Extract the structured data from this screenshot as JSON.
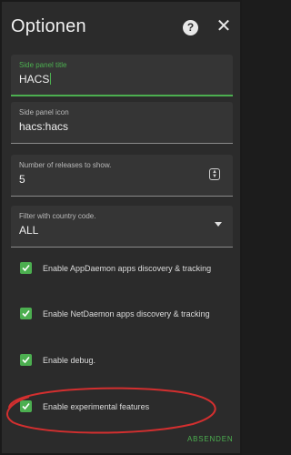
{
  "dialog": {
    "title": "Optionen",
    "help_icon": "help-circle-icon",
    "close_icon": "close-icon",
    "help_glyph": "?",
    "close_glyph": "✕"
  },
  "fields": {
    "side_panel_title": {
      "label": "Side panel title",
      "value": "HACS"
    },
    "side_panel_icon": {
      "label": "Side panel icon",
      "value": "hacs:hacs"
    },
    "releases": {
      "label": "Number of releases to show.",
      "value": "5"
    },
    "country": {
      "label": "Filter with country code.",
      "value": "ALL"
    }
  },
  "checkboxes": [
    {
      "label": "Enable AppDaemon apps discovery & tracking",
      "checked": true
    },
    {
      "label": "Enable NetDaemon apps discovery & tracking",
      "checked": true
    },
    {
      "label": "Enable debug.",
      "checked": true
    },
    {
      "label": "Enable experimental features",
      "checked": true
    }
  ],
  "actions": {
    "submit_label": "ABSENDEN"
  },
  "colors": {
    "accent": "#4caf50",
    "background": "#2b2b2b",
    "annotation": "#d32f2f"
  }
}
